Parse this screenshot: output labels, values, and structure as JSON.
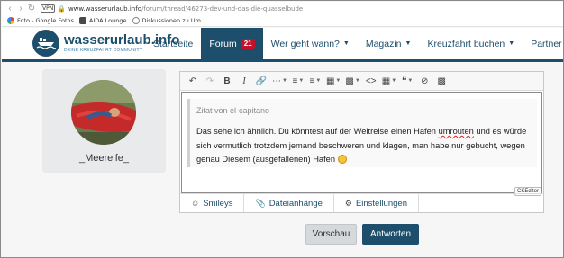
{
  "browser": {
    "vpn_label": "VPN",
    "url_domain": "www.wasserurlaub.info",
    "url_path": "/forum/thread/46273-dev-und-das-die-quasselbude",
    "bookmarks": [
      {
        "label": "Foto - Google Fotos",
        "icon": "google-photos-icon"
      },
      {
        "label": "AIDA Lounge",
        "icon": "aida-icon"
      },
      {
        "label": "Diskussionen zu Um...",
        "icon": "discussion-icon"
      }
    ]
  },
  "site": {
    "logo_title": "wasserurlaub.info",
    "logo_subtitle": "DEINE KREUZFAHRT COMMUNITY",
    "brand_color": "#1d4e6b",
    "nav": [
      {
        "label": "Startseite",
        "active": false,
        "dropdown": false
      },
      {
        "label": "Forum",
        "active": true,
        "badge": "21",
        "dropdown": false
      },
      {
        "label": "Wer geht wann?",
        "active": false,
        "dropdown": true
      },
      {
        "label": "Magazin",
        "active": false,
        "dropdown": true
      },
      {
        "label": "Kreuzfahrt buchen",
        "active": false,
        "dropdown": true
      },
      {
        "label": "Partner",
        "active": false,
        "dropdown": true
      }
    ]
  },
  "profile": {
    "username": "_Meerelfe_"
  },
  "editor": {
    "quote_author": "Zitat von el-capitano",
    "quote_text_1": "Das sehe ich ähnlich. Du könntest auf der Weltreise einen Hafen ",
    "quote_misspelled": "umrouten",
    "quote_text_2": " und es würde sich vermutlich trotzdem jemand beschweren und klagen, man habe nur gebucht, wegen genau Diesem (ausgefallenen) Hafen ",
    "ck_label": "CKEditor",
    "tabs": [
      {
        "label": "Smileys",
        "icon": "smiley-icon"
      },
      {
        "label": "Dateianhänge",
        "icon": "paperclip-icon"
      },
      {
        "label": "Einstellungen",
        "icon": "gear-icon"
      }
    ]
  },
  "actions": {
    "preview_label": "Vorschau",
    "reply_label": "Antworten"
  }
}
